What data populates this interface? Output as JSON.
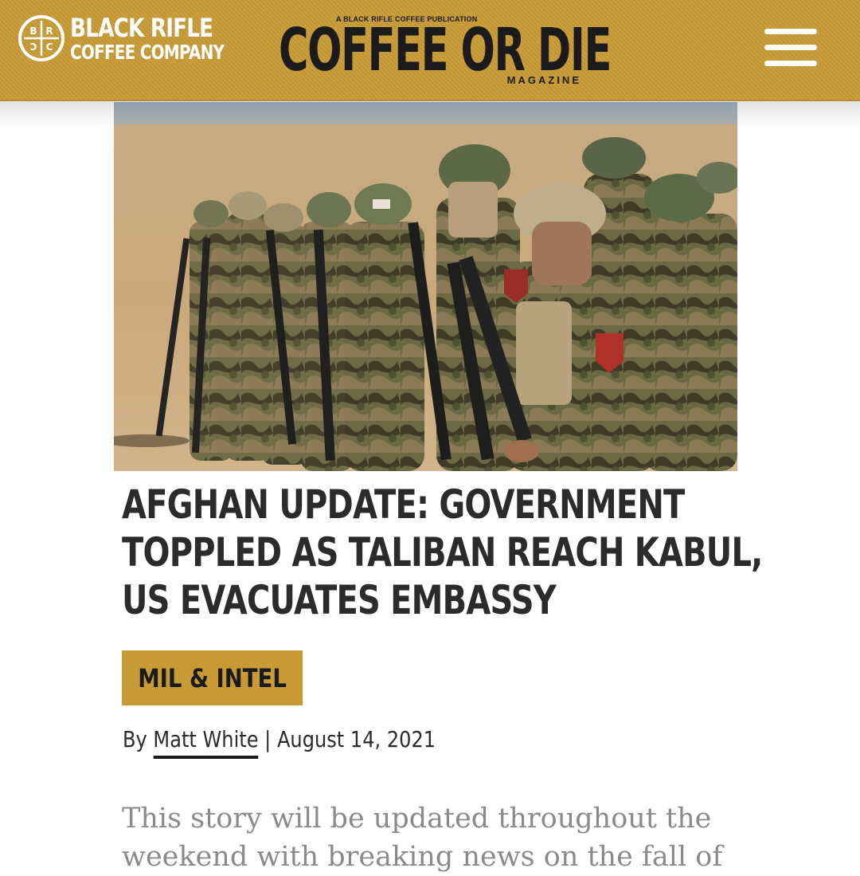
{
  "header": {
    "brand_line1": "BLACK RIFLE",
    "brand_line2": "COFFEE COMPANY",
    "logo_letters": [
      "B",
      "R",
      "C",
      "C"
    ],
    "magazine_pre": "A BLACK RIFLE COFFEE PUBLICATION",
    "magazine_title": "COFFEE OR DIE",
    "magazine_sub": "MAGAZINE",
    "menu_icon": "hamburger-menu-icon",
    "bar_color": "#c79a35"
  },
  "article": {
    "headline_lines": [
      "AFGHAN UPDATE: GOVERNMENT",
      "TOPPLED AS TALIBAN REACH KABUL,",
      "US EVACUATES EMBASSY"
    ],
    "category": "MIL & INTEL",
    "byline_prefix": "By",
    "author": "Matt White",
    "separator": "|",
    "date": "August 14, 2021",
    "body_lines": [
      "This story will be updated throughout the",
      "weekend with breaking news on the fall of"
    ]
  },
  "colors": {
    "accent": "#c79a35",
    "headline": "#2b2b2b",
    "body": "#8a8a8a"
  }
}
